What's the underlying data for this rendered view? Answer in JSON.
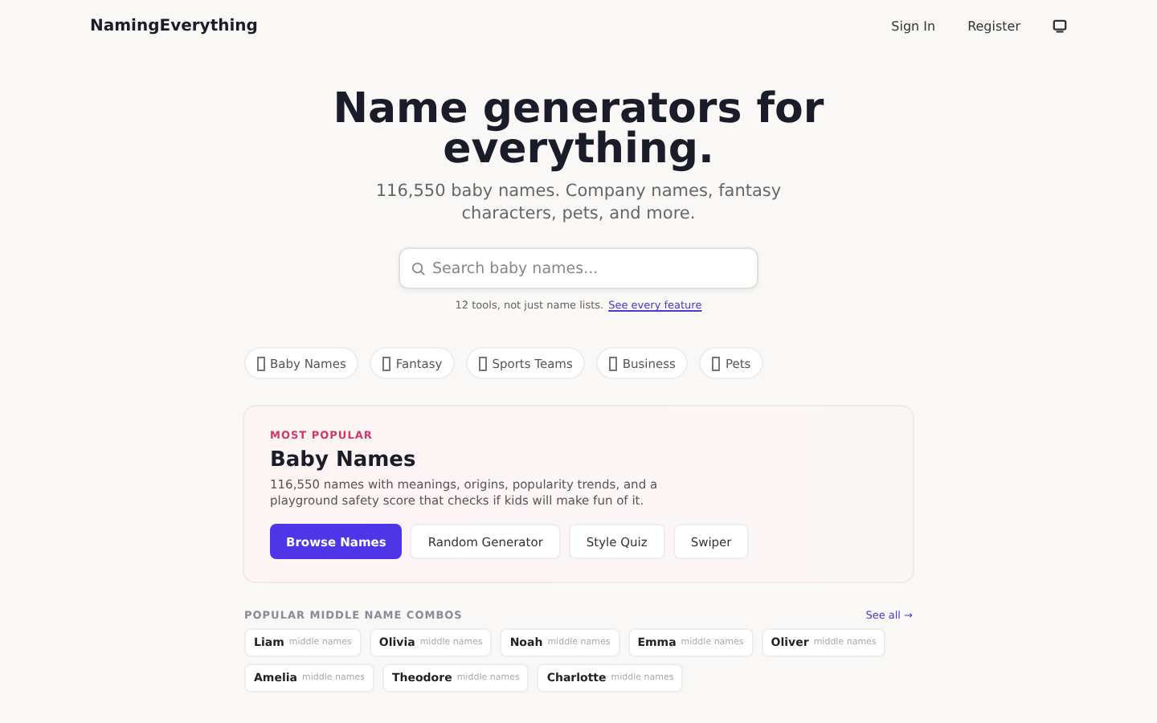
{
  "header": {
    "logo": "NamingEverything",
    "links": [
      "Sign In",
      "Register"
    ]
  },
  "hero": {
    "title": "Name generators for everything.",
    "subtitle": "116,550 baby names. Company names, fantasy characters, pets, and more."
  },
  "search": {
    "placeholder": "Search baby names..."
  },
  "tools_note": {
    "text": "12 tools, not just name lists.",
    "link": "See every feature"
  },
  "categories": [
    {
      "label": "Baby Names"
    },
    {
      "label": "Fantasy"
    },
    {
      "label": "Sports Teams"
    },
    {
      "label": "Business"
    },
    {
      "label": "Pets"
    }
  ],
  "featured": {
    "eyebrow": "MOST POPULAR",
    "title": "Baby Names",
    "description": "116,550 names with meanings, origins, popularity trends, and a playground safety score that checks if kids will make fun of it.",
    "buttons": [
      {
        "label": "Browse Names",
        "kind": "primary"
      },
      {
        "label": "Random Generator",
        "kind": "secondary"
      },
      {
        "label": "Style Quiz",
        "kind": "secondary"
      },
      {
        "label": "Swiper",
        "kind": "secondary"
      }
    ]
  },
  "combos": {
    "heading": "POPULAR MIDDLE NAME COMBOS",
    "see_all": "See all →",
    "items": [
      {
        "name": "Liam",
        "suffix": "middle names"
      },
      {
        "name": "Olivia",
        "suffix": "middle names"
      },
      {
        "name": "Noah",
        "suffix": "middle names"
      },
      {
        "name": "Emma",
        "suffix": "middle names"
      },
      {
        "name": "Oliver",
        "suffix": "middle names"
      },
      {
        "name": "Amelia",
        "suffix": "middle names"
      },
      {
        "name": "Theodore",
        "suffix": "middle names"
      },
      {
        "name": "Charlotte",
        "suffix": "middle names"
      }
    ]
  }
}
